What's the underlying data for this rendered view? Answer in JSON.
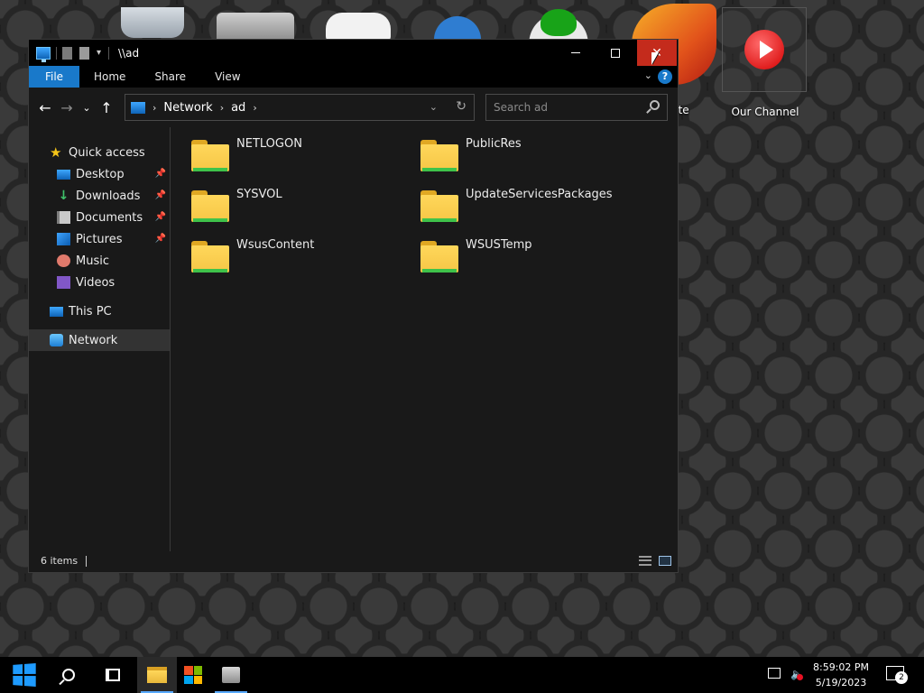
{
  "desktop": {
    "icons": [
      {
        "name": "Recycle Bin",
        "label": ""
      },
      {
        "name": "Folder",
        "label": ""
      },
      {
        "name": "Gamepad",
        "label": ""
      },
      {
        "name": "Blue App",
        "label": ""
      },
      {
        "name": "Xbox",
        "label": ""
      },
      {
        "name": "Website",
        "label": "site"
      },
      {
        "name": "Our Channel",
        "label": "Our Channel"
      }
    ]
  },
  "window": {
    "title": "\\\\ad",
    "ribbon_tabs": [
      "File",
      "Home",
      "Share",
      "View"
    ],
    "help_label": "?"
  },
  "address": {
    "crumbs": [
      "Network",
      "ad"
    ]
  },
  "search": {
    "placeholder": "Search ad"
  },
  "nav_pane": {
    "quick_access": "Quick access",
    "items": [
      {
        "label": "Desktop",
        "icon": "desktop-icon",
        "pinned": true
      },
      {
        "label": "Downloads",
        "icon": "downloads-icon",
        "pinned": true
      },
      {
        "label": "Documents",
        "icon": "documents-icon",
        "pinned": true
      },
      {
        "label": "Pictures",
        "icon": "pictures-icon",
        "pinned": true
      },
      {
        "label": "Music",
        "icon": "music-icon",
        "pinned": false
      },
      {
        "label": "Videos",
        "icon": "videos-icon",
        "pinned": false
      }
    ],
    "this_pc": "This PC",
    "network": "Network",
    "selected": "Network"
  },
  "files": [
    {
      "name": "NETLOGON",
      "type": "folder"
    },
    {
      "name": "PublicRes",
      "type": "folder"
    },
    {
      "name": "SYSVOL",
      "type": "folder"
    },
    {
      "name": "UpdateServicesPackages",
      "type": "folder"
    },
    {
      "name": "WsusContent",
      "type": "folder"
    },
    {
      "name": "WSUSTemp",
      "type": "folder"
    }
  ],
  "status": {
    "item_count": "6 items"
  },
  "taskbar": {
    "time": "8:59:02 PM",
    "date": "5/19/2023",
    "notification_count": "2"
  },
  "colors": {
    "accent": "#1979ca",
    "close_button": "#c42b1c",
    "window_bg": "#191919"
  }
}
